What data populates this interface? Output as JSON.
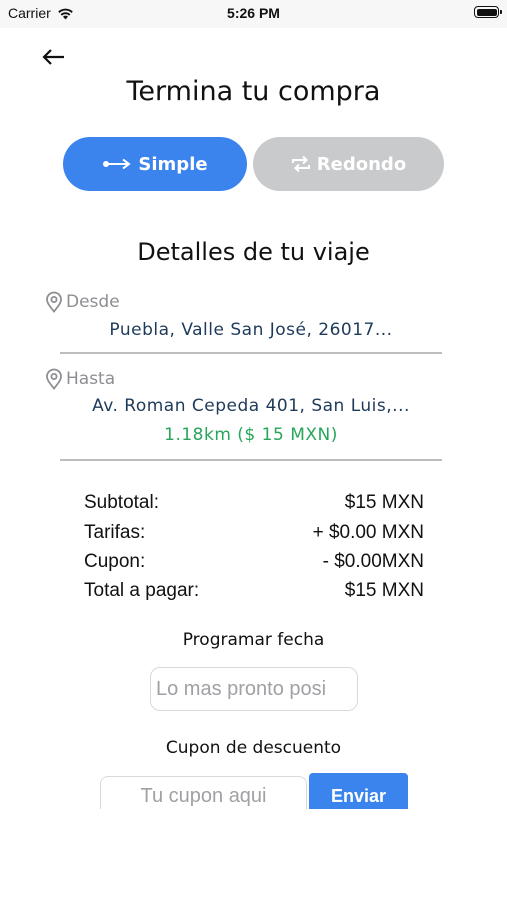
{
  "status_bar": {
    "carrier": "Carrier",
    "time": "5:26 PM"
  },
  "header": {
    "title": "Termina tu compra"
  },
  "trip_type": {
    "simple_label": "Simple",
    "round_label": "Redondo",
    "selected": "Simple"
  },
  "details": {
    "title": "Detalles de tu viaje",
    "from_label": "Desde",
    "from_value": "Puebla, Valle San José, 26017...",
    "to_label": "Hasta",
    "to_value": "Av. Roman Cepeda 401, San Luis,...",
    "distance": "1.18km ($ 15 MXN)"
  },
  "summary": [
    {
      "label": "Subtotal:",
      "value": "$15 MXN"
    },
    {
      "label": "Tarifas:",
      "value": "+ $0.00 MXN"
    },
    {
      "label": "Cupon:",
      "value": "- $0.00MXN"
    },
    {
      "label": "Total a pagar:",
      "value": "$15 MXN"
    }
  ],
  "schedule": {
    "title": "Programar fecha",
    "placeholder": "Lo mas pronto posi"
  },
  "coupon": {
    "title": "Cupon de descuento",
    "placeholder": "Tu cupon aqui",
    "button_label": "Enviar"
  },
  "colors": {
    "primary": "#3b84ee",
    "inactive": "#c8cacc",
    "address": "#1d3a5a",
    "distance": "#27a55a"
  },
  "icons": [
    "wifi-icon",
    "battery-icon",
    "back-arrow-icon",
    "one-way-arrow-icon",
    "repeat-icon",
    "location-pin-icon"
  ]
}
